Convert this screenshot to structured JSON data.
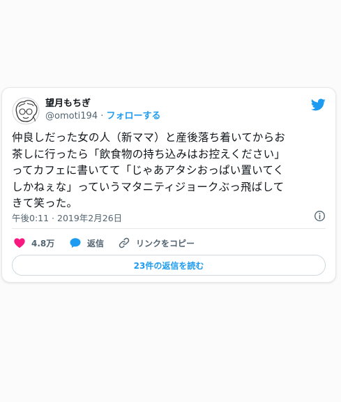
{
  "tweet": {
    "author": {
      "display_name": "望月もちぎ",
      "handle": "@omoti194",
      "separator": " · ",
      "follow_label": "フォローする"
    },
    "text": "仲良しだった女の人（新ママ）と産後落ち着いてからお\n茶しに行ったら「飲食物の持ち込みはお控えください」\nってカフェに書いてて「じゃあアタシおっぱい置いてく\nしかねぇな」っていうマタニティジョークぶっ飛ばして\nきて笑った。",
    "timestamp": "午後0:11 · 2019年2月26日",
    "likes": "4.8万",
    "reply_label": "返信",
    "copy_link_label": "リンクをコピー",
    "read_replies_label": "23件の返信を読む"
  },
  "colors": {
    "accent": "#1d9bf0",
    "like": "#f91880",
    "text": "#0f1419",
    "muted": "#536471"
  },
  "icons": [
    "avatar-illustration",
    "twitter-bird-icon",
    "info-icon",
    "heart-icon",
    "reply-bubble-icon",
    "link-icon"
  ]
}
